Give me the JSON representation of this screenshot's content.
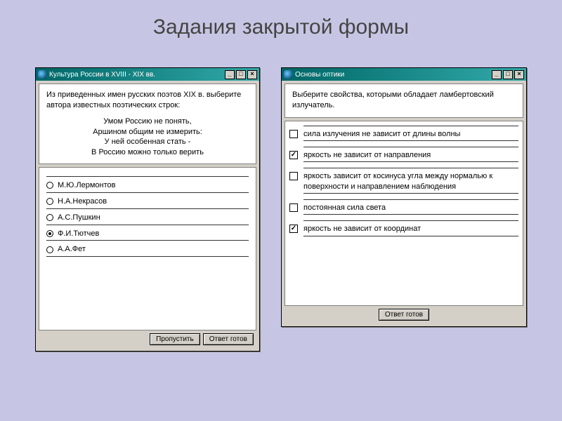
{
  "slide_title": "Задания закрытой формы",
  "win1": {
    "title": "Культура России в XVIII - XIX вв.",
    "question": "Из приведенных имен русских поэтов XIX в. выберите автора известных поэтических строк:",
    "poem_lines": [
      "Умом Россию не понять,",
      "Аршином общим не измерить:",
      "У ней особенная стать -",
      "В Россию можно только верить"
    ],
    "options": [
      {
        "label": "М.Ю.Лермонтов",
        "selected": false
      },
      {
        "label": "Н.А.Некрасов",
        "selected": false
      },
      {
        "label": "А.С.Пушкин",
        "selected": false
      },
      {
        "label": "Ф.И.Тютчев",
        "selected": true
      },
      {
        "label": "А.А.Фет",
        "selected": false
      }
    ],
    "skip_label": "Пропустить",
    "submit_label": "Ответ готов"
  },
  "win2": {
    "title": "Основы оптики",
    "question": "Выберите свойства, которыми обладает ламбертовский излучатель.",
    "options": [
      {
        "label": "сила излучения не зависит от длины волны",
        "checked": false
      },
      {
        "label": "яркость не зависит от направления",
        "checked": true
      },
      {
        "label": "яркость зависит от косинуса угла между нормалью к поверхности и направлением наблюдения",
        "checked": false
      },
      {
        "label": "постоянная сила света",
        "checked": false
      },
      {
        "label": "яркость не зависит от координат",
        "checked": true
      }
    ],
    "submit_label": "Ответ готов"
  },
  "window_controls": {
    "min": "_",
    "max": "□",
    "close": "×"
  }
}
